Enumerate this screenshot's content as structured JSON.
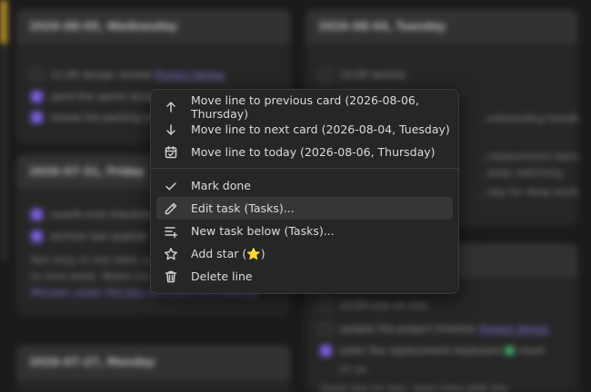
{
  "cards": [
    {
      "date": "2026-08-05, Wednesday",
      "tasks": [
        {
          "text": "11:00 design review",
          "link": "Project Vertex",
          "done": false
        },
        {
          "text": "send the sprint recap",
          "done": true
        },
        {
          "text": "renew the parking permit",
          "done": true
        }
      ]
    },
    {
      "date": "2026-08-04, Tuesday",
      "tasks": [
        {
          "text": "14:00 dentist",
          "done": false
        }
      ],
      "notes": [
        "...onboarding handbook",
        "...replacement twice",
        "...keep switching",
        "...day for deep work"
      ]
    },
    {
      "date": "2026-07-31, Friday",
      "tasks": [
        {
          "text": "month-end checklist",
          "done": true
        },
        {
          "text": "archive last quarter",
          "done": true
        }
      ],
      "notes": [
        "Ran long on the retro, pushed two items",
        "to next week. Notes cleaned up in",
        "Minutes under the July retrospective heading."
      ],
      "note_link": "Minutes"
    },
    {
      "date": "",
      "tasks": [
        {
          "text": "10:00 one on one",
          "done": false
        },
        {
          "text": "update the project timeline",
          "link": "Project Vertex",
          "done": false
        },
        {
          "text": "order the replacement keyboard",
          "suffix": "more",
          "done": true
        }
      ],
      "notes": [
        "on us",
        "Good one on one, more time with the"
      ]
    },
    {
      "date": "2026-07-27, Monday",
      "tasks": []
    }
  ],
  "context_menu": {
    "group1": [
      {
        "label": "Move line to previous card (2026-08-06, Thursday)",
        "icon": "arrow-up-icon"
      },
      {
        "label": "Move line to next card (2026-08-04, Tuesday)",
        "icon": "arrow-down-icon"
      },
      {
        "label": "Move line to today (2026-08-06, Thursday)",
        "icon": "calendar-check-icon"
      }
    ],
    "group2": [
      {
        "label": "Mark done",
        "icon": "check-icon"
      },
      {
        "label": "Edit task (Tasks)...",
        "icon": "pencil-icon",
        "highlighted": true
      },
      {
        "label": "New task below (Tasks)...",
        "icon": "list-plus-icon"
      },
      {
        "label": "Add star (⭐)",
        "icon": "star-icon"
      },
      {
        "label": "Delete line",
        "icon": "trash-icon"
      }
    ]
  }
}
